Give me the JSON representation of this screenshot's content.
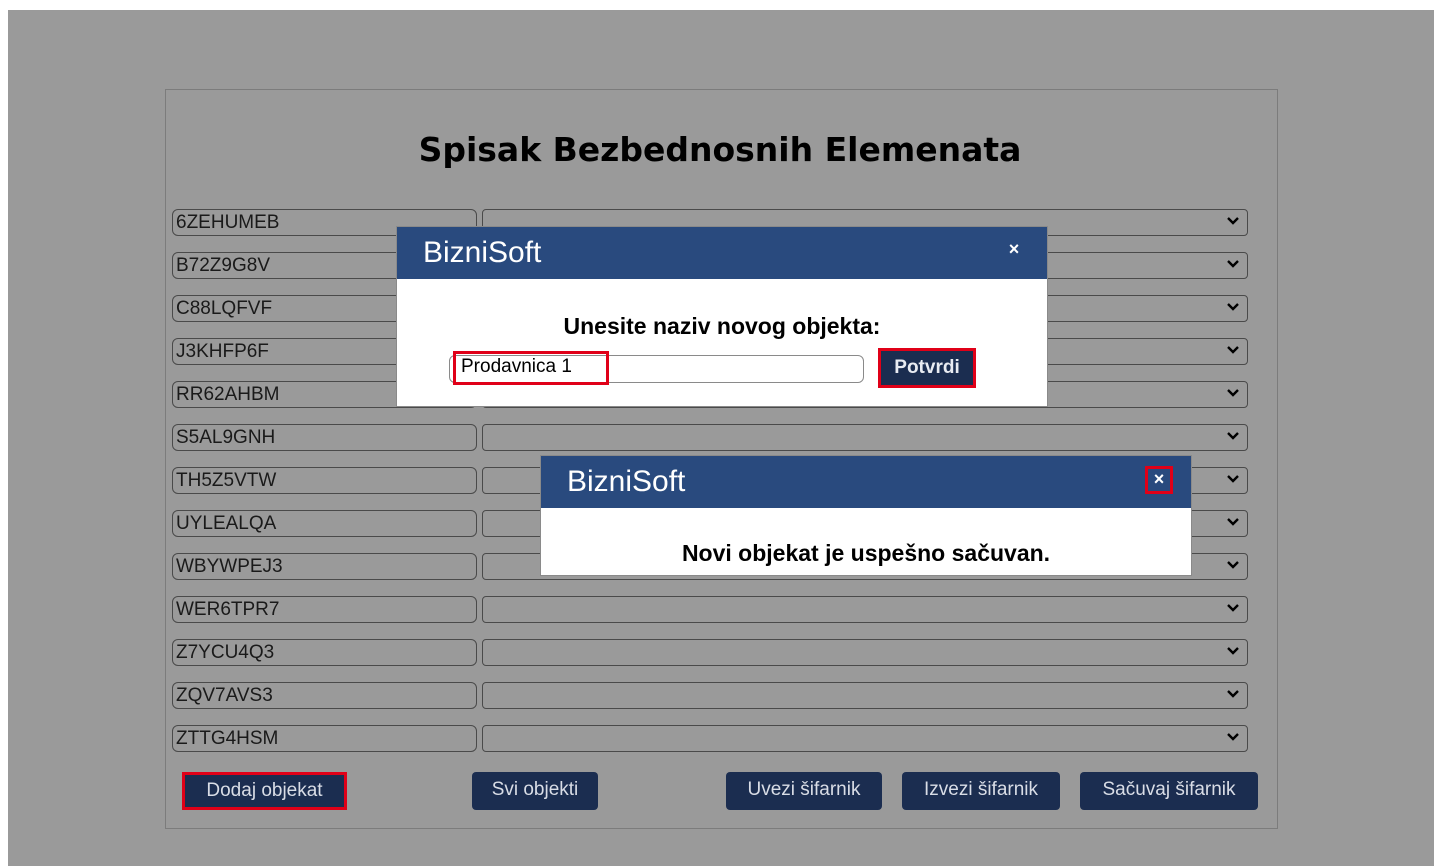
{
  "page": {
    "title": "Spisak Bezbednosnih Elemenata",
    "rows": [
      {
        "code": "6ZEHUMEB"
      },
      {
        "code": "B72Z9G8V"
      },
      {
        "code": "C88LQFVF"
      },
      {
        "code": "J3KHFP6F"
      },
      {
        "code": "RR62AHBM"
      },
      {
        "code": "S5AL9GNH"
      },
      {
        "code": "TH5Z5VTW"
      },
      {
        "code": "UYLEALQA"
      },
      {
        "code": "WBYWPEJ3"
      },
      {
        "code": "WER6TPR7"
      },
      {
        "code": "Z7YCU4Q3"
      },
      {
        "code": "ZQV7AVS3"
      },
      {
        "code": "ZTTG4HSM"
      }
    ]
  },
  "buttons": {
    "add_object": "Dodaj objekat",
    "all_objects": "Svi objekti",
    "import": "Uvezi šifarnik",
    "export": "Izvezi šifarnik",
    "save": "Sačuvaj šifarnik"
  },
  "dialog_input": {
    "title": "BizniSoft",
    "close": "×",
    "prompt": "Unesite naziv novog objekta:",
    "value": "Prodavnica 1",
    "confirm": "Potvrdi"
  },
  "dialog_success": {
    "title": "BizniSoft",
    "close": "×",
    "message": "Novi objekat je uspešno sačuvan."
  },
  "colors": {
    "overlay": "#9a9a9a",
    "dialog_header": "#294a7e",
    "button": "#1b2d50",
    "highlight": "#e00018"
  }
}
